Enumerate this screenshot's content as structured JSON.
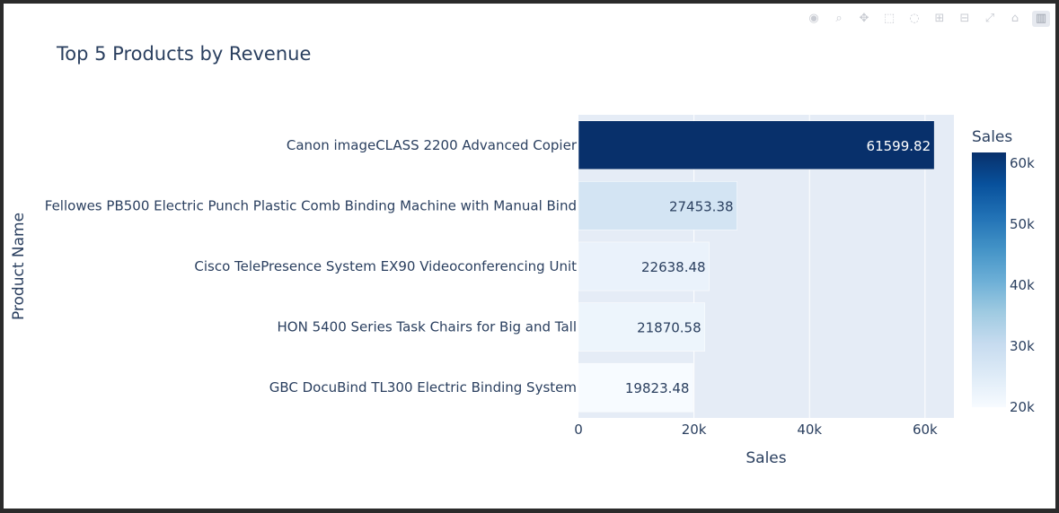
{
  "chart_data": {
    "type": "bar",
    "orientation": "horizontal",
    "title": "Top 5 Products by Revenue",
    "xlabel": "Sales",
    "ylabel": "Product Name",
    "categories": [
      "Canon imageCLASS 2200 Advanced Copier",
      "Fellowes PB500 Electric Punch Plastic Comb Binding Machine with Manual Bind",
      "Cisco TelePresence System EX90 Videoconferencing Unit",
      "HON 5400 Series Task Chairs for Big and Tall",
      "GBC DocuBind TL300 Electric Binding System"
    ],
    "values": [
      61599.82,
      27453.38,
      22638.48,
      21870.58,
      19823.48
    ],
    "value_labels": [
      "61599.82",
      "27453.38",
      "22638.48",
      "21870.58",
      "19823.48"
    ],
    "xlim": [
      0,
      65000
    ],
    "xticks": [
      {
        "value": 0,
        "label": "0"
      },
      {
        "value": 20000,
        "label": "20k"
      },
      {
        "value": 40000,
        "label": "40k"
      },
      {
        "value": 60000,
        "label": "60k"
      }
    ],
    "grid": true,
    "colorbar": {
      "title": "Sales",
      "colorscale": "Blues",
      "range": [
        19823.48,
        61599.82
      ],
      "ticks": [
        {
          "value": 20000,
          "label": "20k"
        },
        {
          "value": 30000,
          "label": "30k"
        },
        {
          "value": 40000,
          "label": "40k"
        },
        {
          "value": 50000,
          "label": "50k"
        },
        {
          "value": 60000,
          "label": "60k"
        }
      ]
    }
  },
  "modebar": {
    "icons": [
      "camera-icon",
      "zoom-icon",
      "pan-icon",
      "box-select-icon",
      "lasso-icon",
      "zoom-in-icon",
      "zoom-out-icon",
      "autoscale-icon",
      "reset-axes-icon",
      "plotly-logo-icon"
    ]
  },
  "colors": {
    "plot_bg": "#e5ecf6",
    "text": "#2a3f5f",
    "grid": "#ffffff"
  }
}
